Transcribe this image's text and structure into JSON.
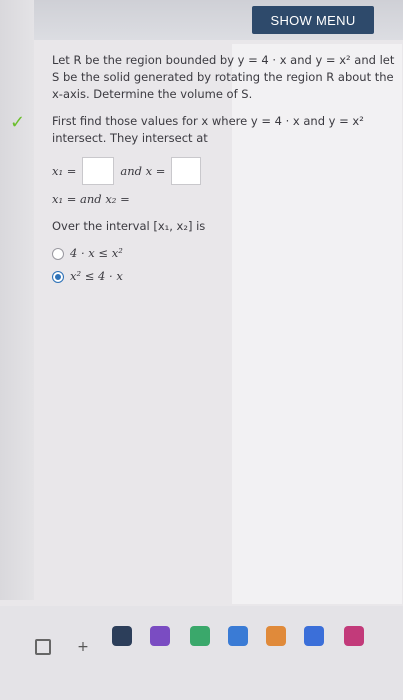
{
  "header": {
    "menu_label": "SHOW MENU"
  },
  "question": {
    "text_1": "Let R be the region bounded by y = 4 · x and y = x² and let S be the solid generated by rotating the region R about the x-axis. Determine the volume of S.",
    "text_2": "First find those values for x where y = 4 · x and y = x² intersect. They intersect at",
    "x1_label": "x₁ =",
    "and_x_label": "and x =",
    "x1_and_x2_label": "x₁ =  and x₂ =",
    "interval_text": "Over the interval [x₁, x₂] is",
    "options": [
      {
        "label": "4 · x ≤ x²",
        "selected": false
      },
      {
        "label": "x² ≤ 4 · x",
        "selected": true
      }
    ]
  },
  "colors": {
    "menu_bg": "#2e4a6b",
    "check": "#6bbf2d",
    "radio_selected": "#2f73b8"
  },
  "icons": {
    "check": "check-icon",
    "browser": [
      "tab-icon",
      "plus-icon",
      "snagit-icon",
      "extension-icon",
      "extension-icon",
      "extension-icon",
      "extension-icon",
      "extension-icon",
      "extension-icon"
    ]
  }
}
